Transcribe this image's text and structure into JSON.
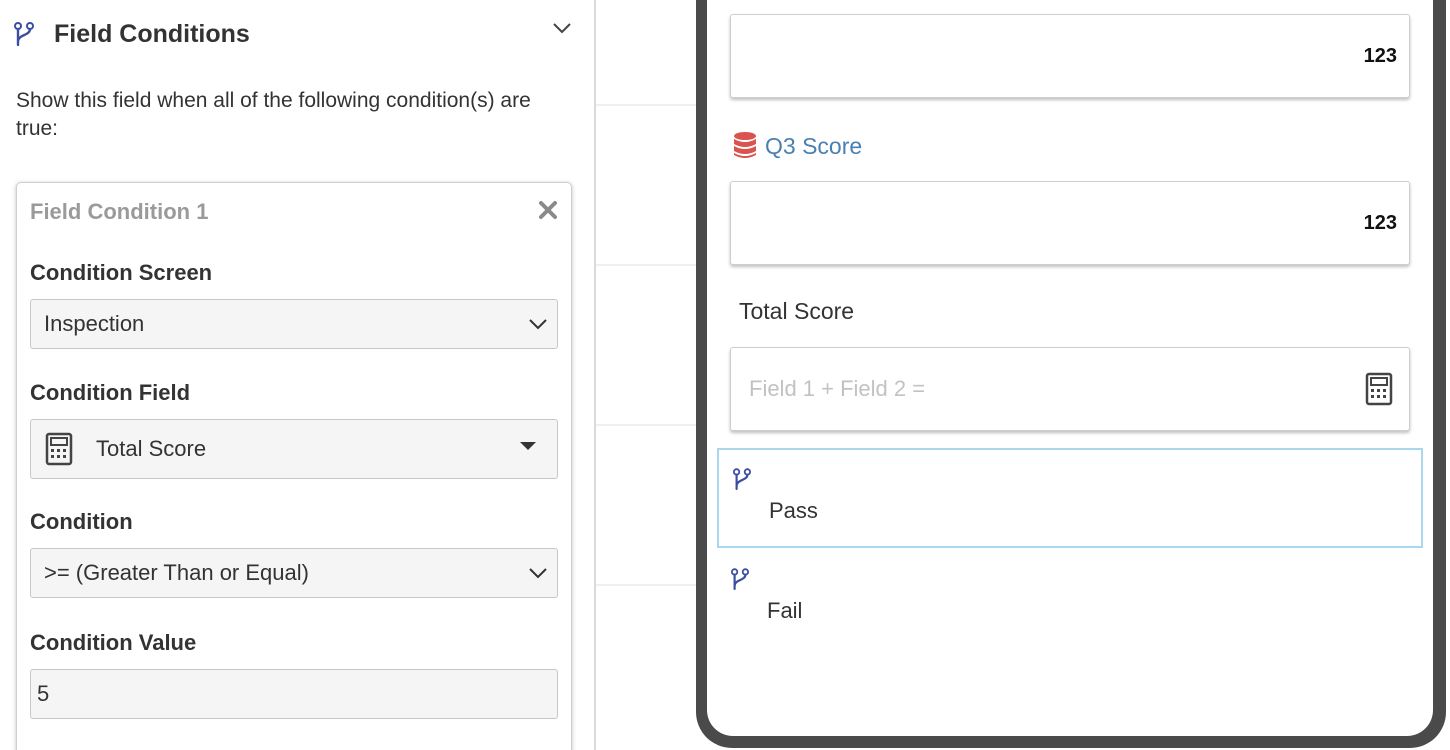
{
  "left_panel": {
    "title": "Field Conditions",
    "description": "Show this field when all of the following condition(s) are true:",
    "condition_card": {
      "title": "Field Condition 1",
      "screen_label": "Condition Screen",
      "screen_value": "Inspection",
      "field_label": "Condition Field",
      "field_value": "Total Score",
      "condition_label": "Condition",
      "condition_value": ">= (Greater Than or Equal)",
      "value_label": "Condition Value",
      "value_input": "5"
    }
  },
  "phone": {
    "q2_value": "123",
    "q3_label": "Q3 Score",
    "q3_value": "123",
    "total_label": "Total Score",
    "total_placeholder": "Field 1 + Field 2 =",
    "branches": [
      {
        "label": "Pass",
        "selected": true
      },
      {
        "label": "Fail",
        "selected": false
      }
    ]
  },
  "colors": {
    "branch_icon": "#3b4ea2",
    "db_icon": "#d9534f",
    "link_label": "#4a7fb1",
    "selected_border": "#a9d8ec",
    "phone_frame": "#4a4a4a"
  },
  "icons": {
    "header": "branch-icon",
    "collapse": "chevron-down-icon",
    "remove": "close-icon",
    "calculator": "calculator-icon",
    "database": "database-icon"
  }
}
